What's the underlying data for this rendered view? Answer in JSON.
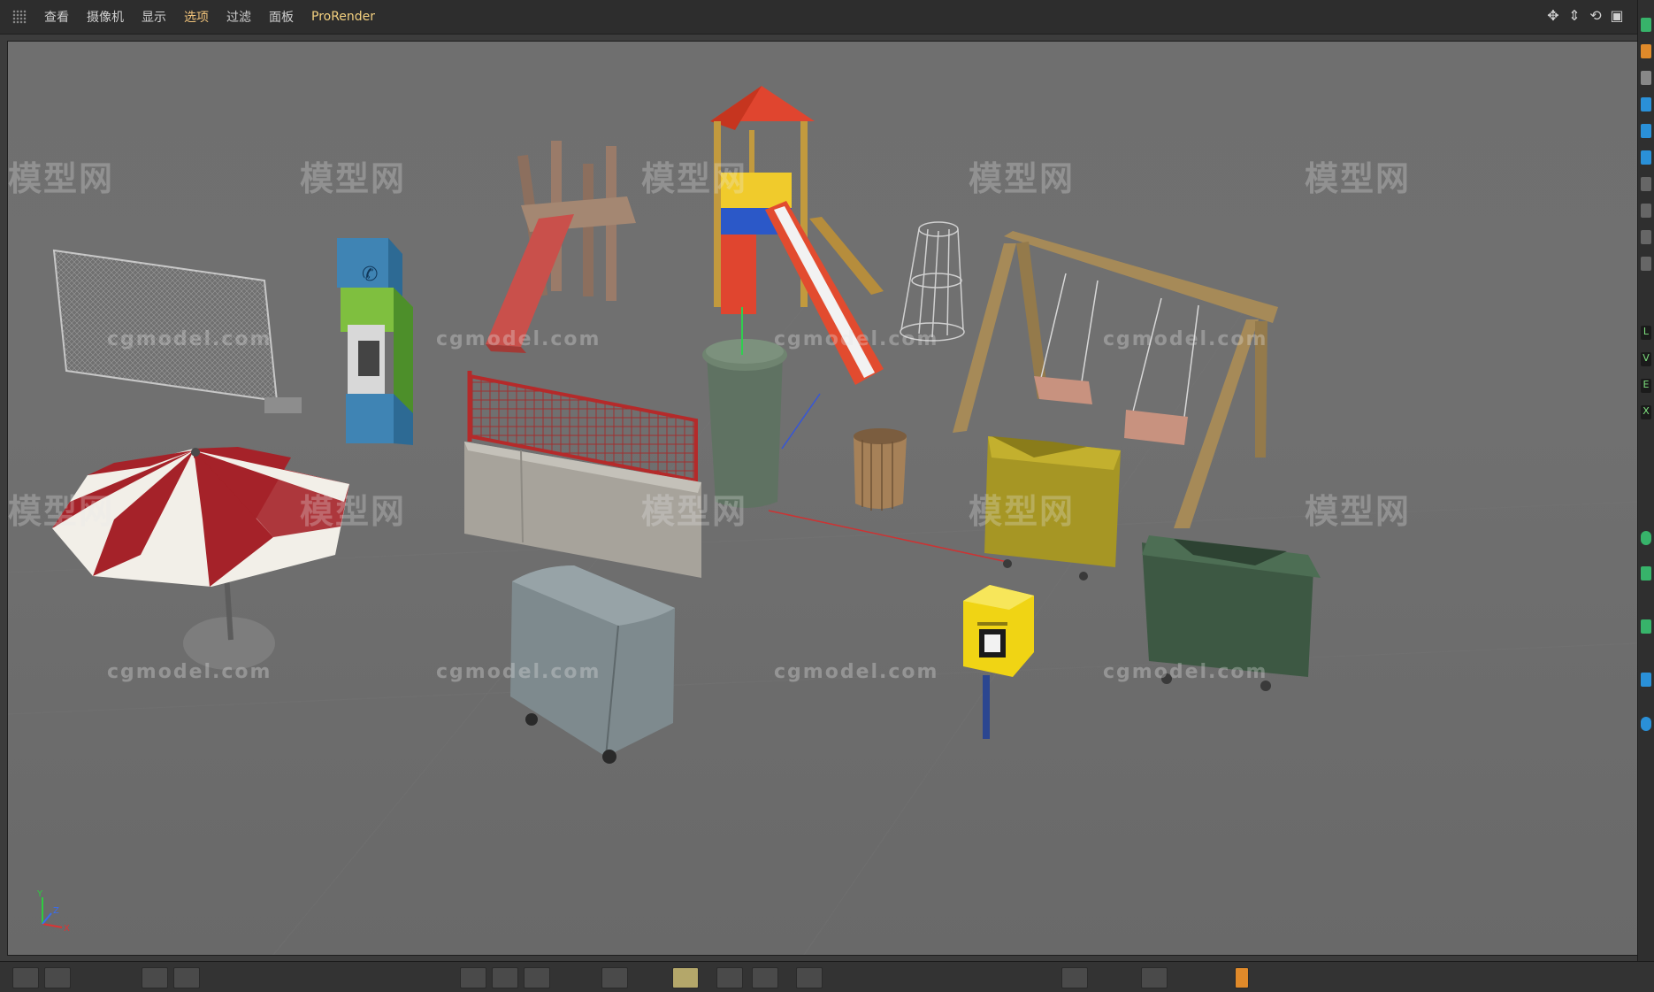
{
  "menubar": {
    "items": [
      {
        "label": "查看",
        "active": false
      },
      {
        "label": "摄像机",
        "active": false
      },
      {
        "label": "显示",
        "active": false
      },
      {
        "label": "选项",
        "active": true
      },
      {
        "label": "过滤",
        "active": false
      },
      {
        "label": "面板",
        "active": false
      },
      {
        "label": "ProRender",
        "active": false
      }
    ],
    "nav_icons": [
      "move-icon",
      "scale-icon",
      "rotate-icon",
      "maximize-icon"
    ]
  },
  "viewport": {
    "watermark_site": "cgmodel.com",
    "watermark_brand": "模型网",
    "axis_labels": {
      "y": "Y",
      "z": "Z",
      "x": "X"
    }
  },
  "right_strip": {
    "letters": [
      "L",
      "V",
      "E",
      "X"
    ]
  },
  "colors": {
    "menu_active": "#f0c27a",
    "viewport_bg": "#6e6e6e",
    "accent_bar": "#f3d07f"
  }
}
